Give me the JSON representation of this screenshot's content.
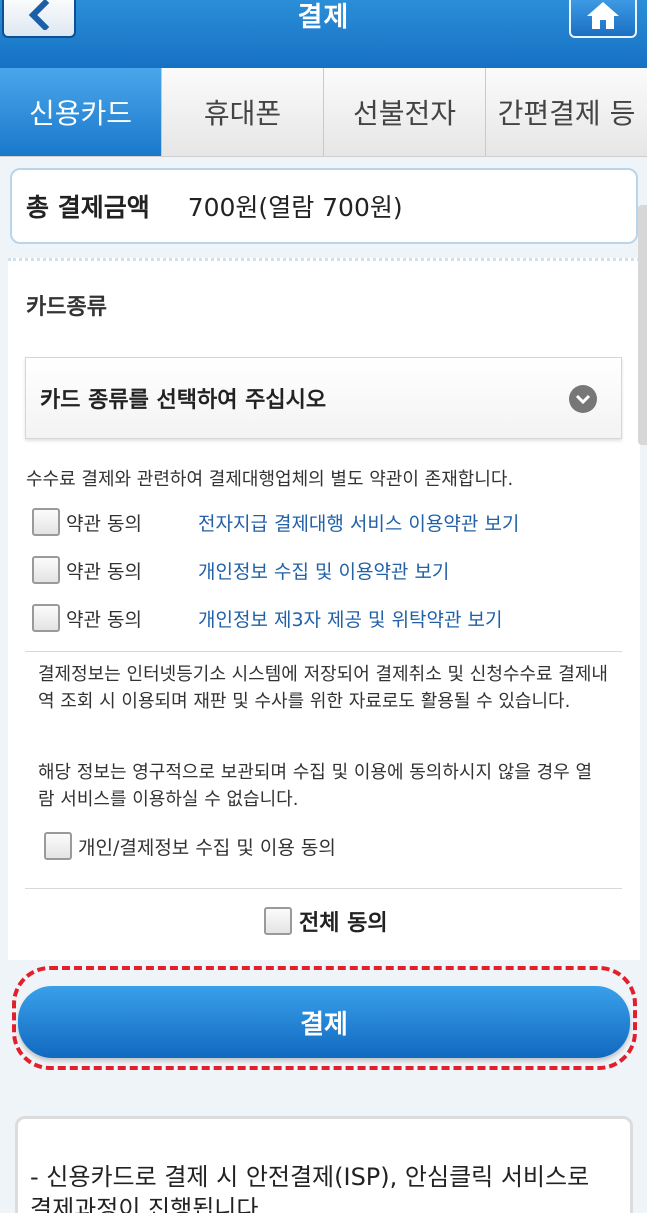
{
  "header": {
    "title": "결제",
    "back_icon": "chevron-left-icon",
    "home_icon": "home-icon"
  },
  "tabs": [
    {
      "label": "신용카드",
      "active": true
    },
    {
      "label": "휴대폰",
      "active": false
    },
    {
      "label": "선불전자",
      "active": false
    },
    {
      "label": "간편결제 등",
      "active": false
    }
  ],
  "total": {
    "label": "총 결제금액",
    "value": "700원(열람 700원)"
  },
  "card": {
    "type_label": "카드종류",
    "select_placeholder": "카드 종류를 선택하여 주십시오"
  },
  "terms": {
    "notice": "수수료 결제와 관련하여 결제대행업체의 별도 약관이 존재합니다.",
    "items": [
      {
        "label": "약관 동의",
        "link": "전자지급 결제대행 서비스 이용약관 보기"
      },
      {
        "label": "약관 동의",
        "link": "개인정보 수집 및 이용약관 보기"
      },
      {
        "label": "약관 동의",
        "link": "개인정보 제3자 제공 및 위탁약관 보기"
      }
    ]
  },
  "privacy": {
    "para1": "결제정보는 인터넷등기소 시스템에 저장되어 결제취소 및 신청수수료 결제내역 조회 시 이용되며 재판 및 수사를 위한 자료로도 활용될 수 있습니다.",
    "para2": "해당 정보는 영구적으로 보관되며 수집 및 이용에 동의하시지 않을 경우 열람 서비스를 이용하실 수 없습니다.",
    "consent_label": "개인/결제정보 수집 및 이용 동의"
  },
  "all_agree_label": "전체 동의",
  "pay_button_label": "결제",
  "info": {
    "text": "- 신용카드로 결제 시 안전결제(ISP), 안심클릭 서비스로 결제과정이 진행됩니다."
  },
  "colors": {
    "primary": "#1a78cc",
    "link": "#2261a8",
    "highlight": "#e2202b"
  }
}
